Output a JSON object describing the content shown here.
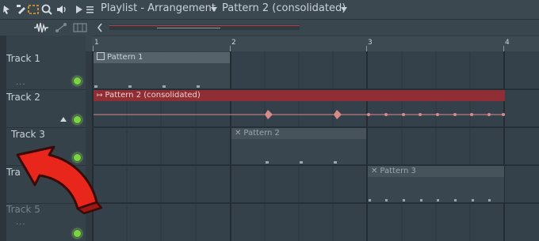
{
  "window": {
    "title_prefix": "Playlist - Arrangement",
    "pattern_selector": "Pattern 2 (consolidated)"
  },
  "ruler": {
    "bars": [
      "1",
      "2",
      "3",
      "4"
    ]
  },
  "tracks": [
    {
      "name": "Track 1"
    },
    {
      "name": "Track 2"
    },
    {
      "name": "Track 3"
    },
    {
      "name": "Track 4",
      "visible_text": "Tra"
    },
    {
      "name": "Track 5"
    }
  ],
  "clips": {
    "p1": "Pattern 1",
    "p2c": "Pattern 2 (consolidated)",
    "p2": "Pattern 2",
    "p3": "Pattern 3"
  },
  "track_dots": "...",
  "colors": {
    "accent_red": "#e8261c",
    "led_green": "#7bd34a",
    "clip_red": "#8f2f35"
  }
}
